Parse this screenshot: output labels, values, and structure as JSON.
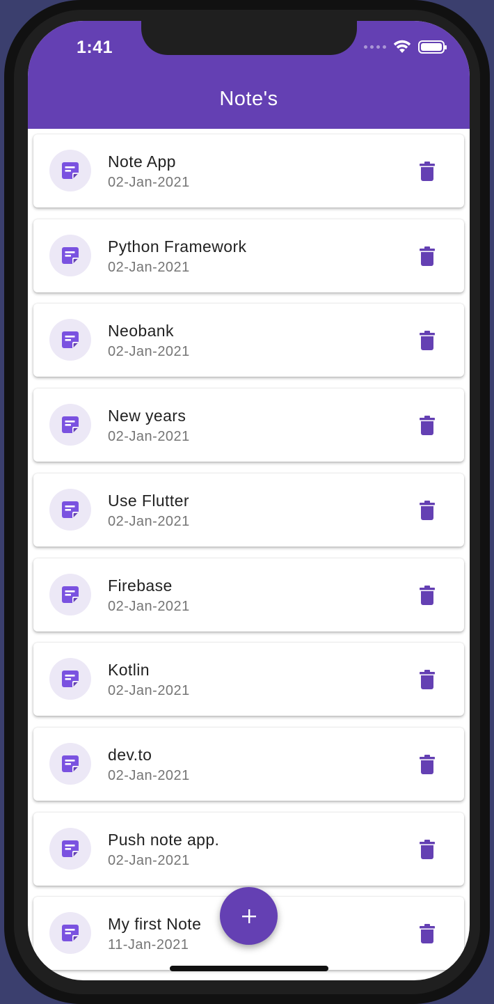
{
  "status_bar": {
    "time": "1:41"
  },
  "appbar": {
    "title": "Note's"
  },
  "colors": {
    "accent": "#6440b3",
    "avatar_bg": "#ece8f6",
    "date_text": "#757575"
  },
  "icons": {
    "note": "sticky-note-icon",
    "delete": "trash-icon",
    "add": "plus-icon"
  },
  "notes": [
    {
      "title": "Note App",
      "date": "02-Jan-2021"
    },
    {
      "title": "Python Framework",
      "date": "02-Jan-2021"
    },
    {
      "title": "Neobank",
      "date": "02-Jan-2021"
    },
    {
      "title": "New years",
      "date": "02-Jan-2021"
    },
    {
      "title": "Use Flutter",
      "date": "02-Jan-2021"
    },
    {
      "title": "Firebase",
      "date": "02-Jan-2021"
    },
    {
      "title": "Kotlin",
      "date": "02-Jan-2021"
    },
    {
      "title": "dev.to",
      "date": "02-Jan-2021"
    },
    {
      "title": "Push note app.",
      "date": "02-Jan-2021"
    },
    {
      "title": "My first Note",
      "date": "11-Jan-2021"
    }
  ],
  "fab": {
    "label": "+"
  }
}
